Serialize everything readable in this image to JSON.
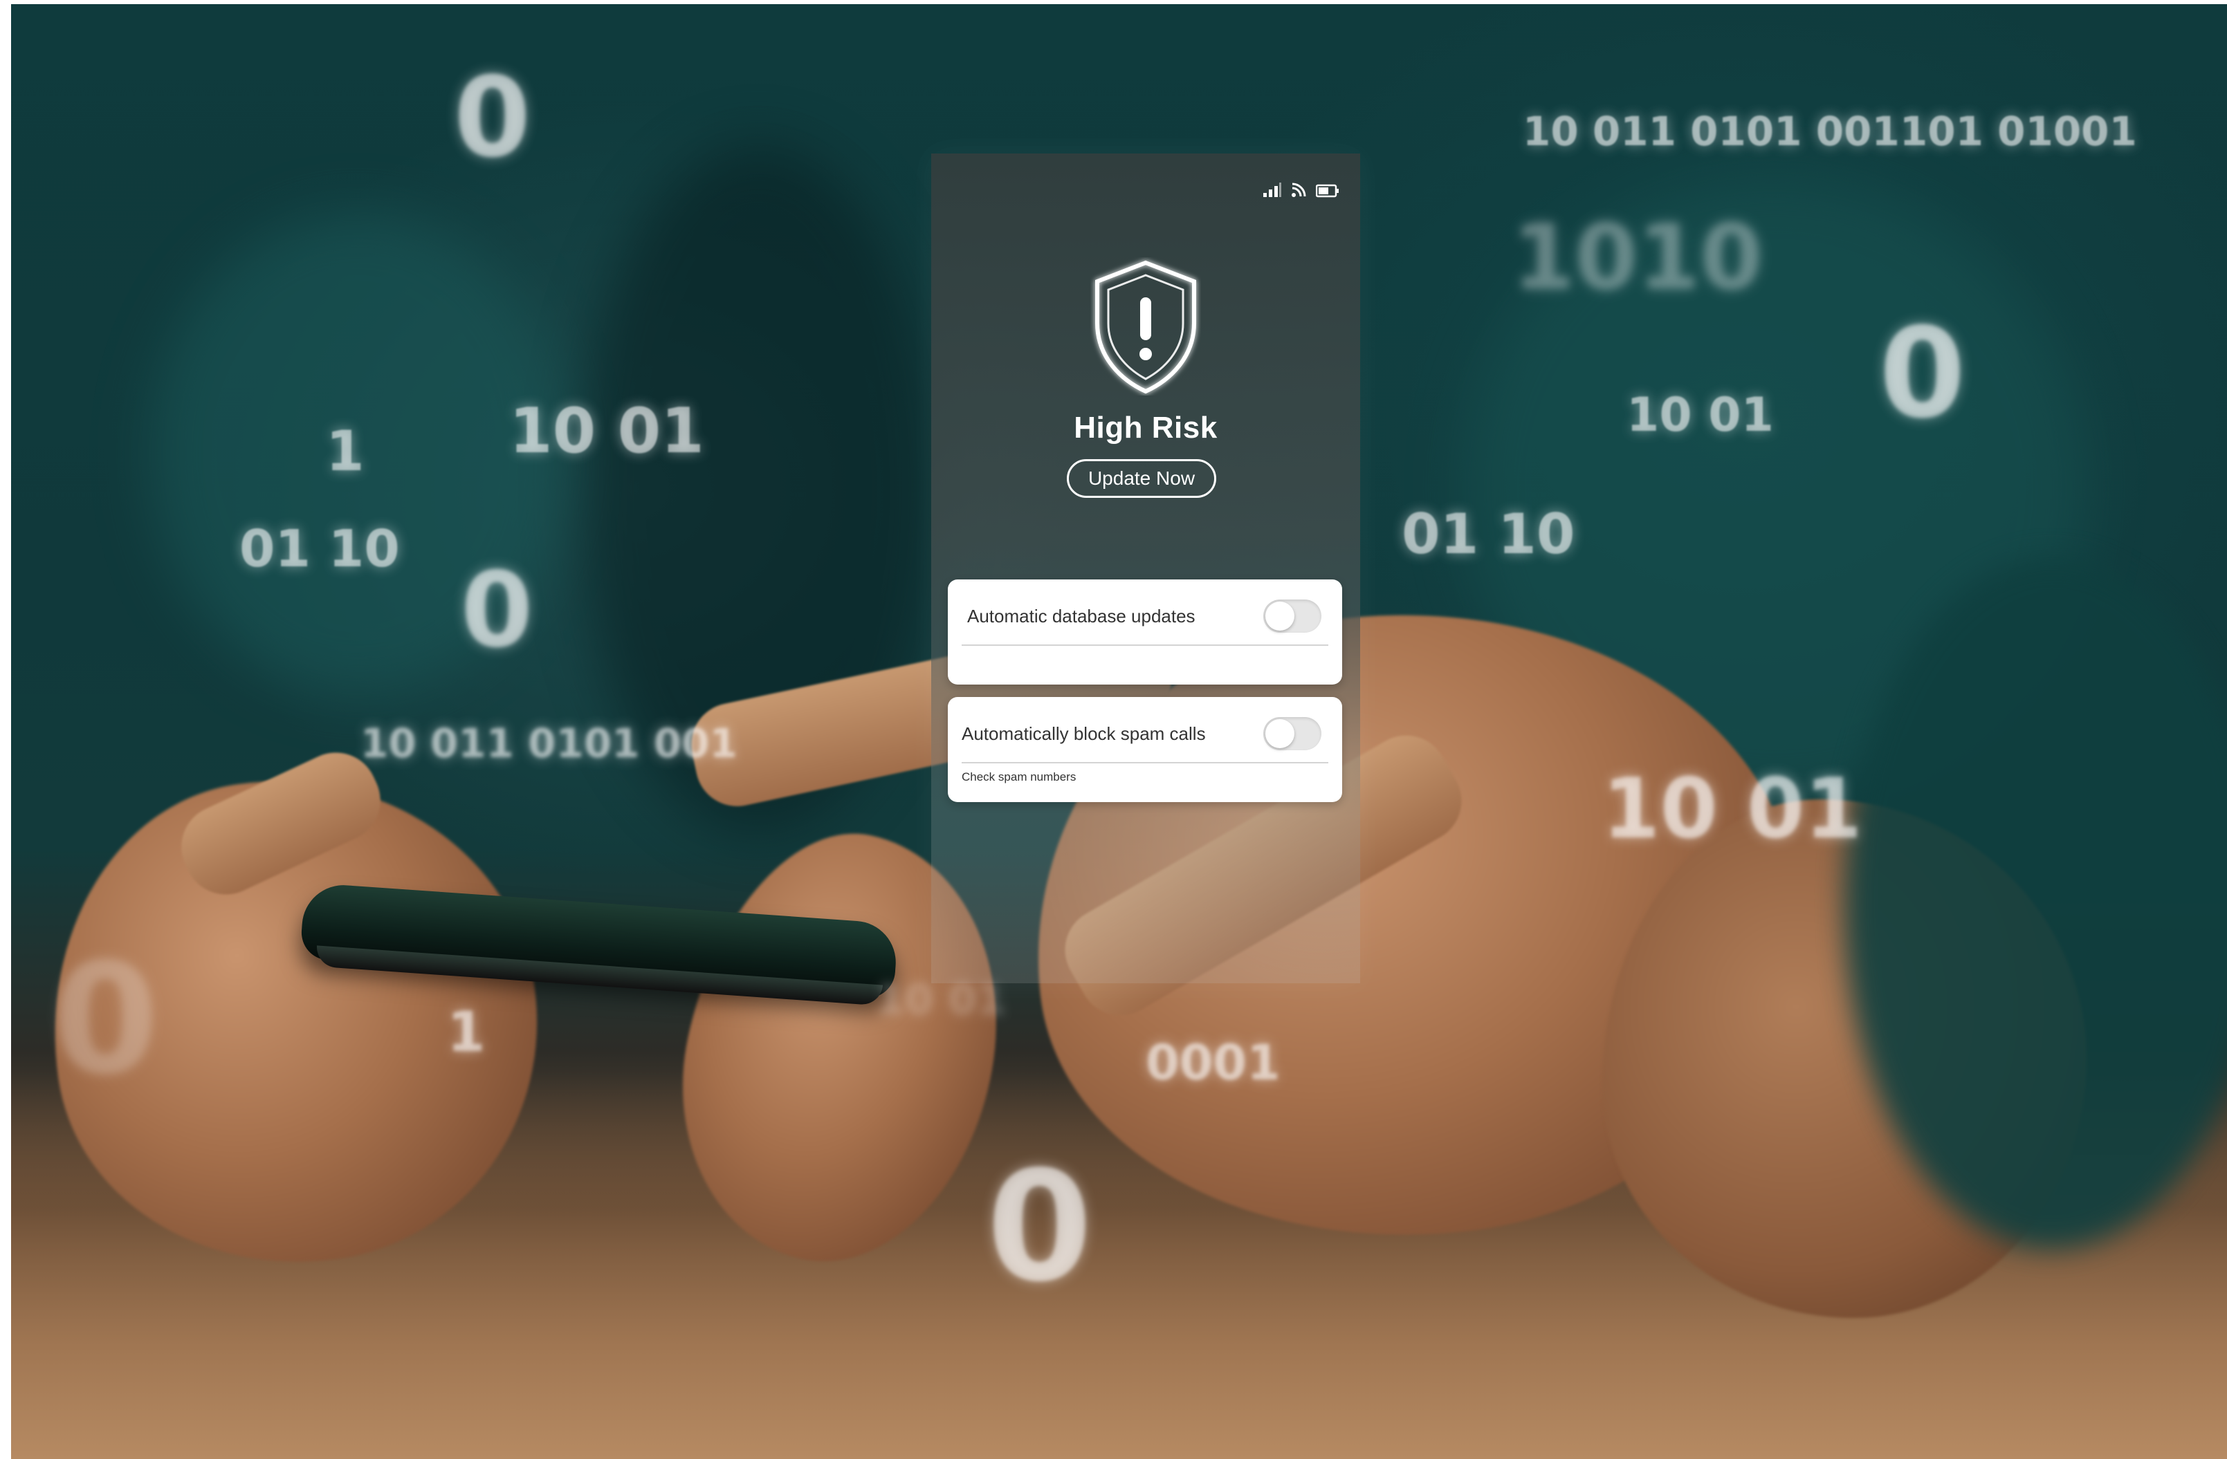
{
  "panel": {
    "alert_title": "High Risk",
    "update_button_label": "Update Now",
    "status_icons": [
      "signal-icon",
      "wifi-icon",
      "battery-icon"
    ],
    "settings": [
      {
        "label": "Automatic database updates",
        "toggle_on": false,
        "subtext": ""
      },
      {
        "label": "Automatically block spam calls",
        "toggle_on": false,
        "subtext": "Check spam numbers"
      }
    ]
  },
  "background_digits": {
    "top_right_stream": "10 011 0101 001101 01001",
    "right_1010": "1010",
    "right_zero": "0",
    "right_1001_a": "10 01",
    "right_0110": "01 10",
    "right_1001_b": "10 01",
    "left_zero_top": "0",
    "left_one": "1",
    "left_1001": "10 01",
    "left_0110": "01 10",
    "left_zero_mid": "0",
    "left_stream": "10 011 0101 001",
    "left_zero_bottom": "0",
    "small_one": "1",
    "center_0001": "0001",
    "center_zero_bottom": "0",
    "center_1001_small": "10 01"
  },
  "colors": {
    "shirt_teal": "#10393b",
    "panel_dark": "#323e3e",
    "table_wood": "#a57b57",
    "card_white": "#ffffff"
  }
}
